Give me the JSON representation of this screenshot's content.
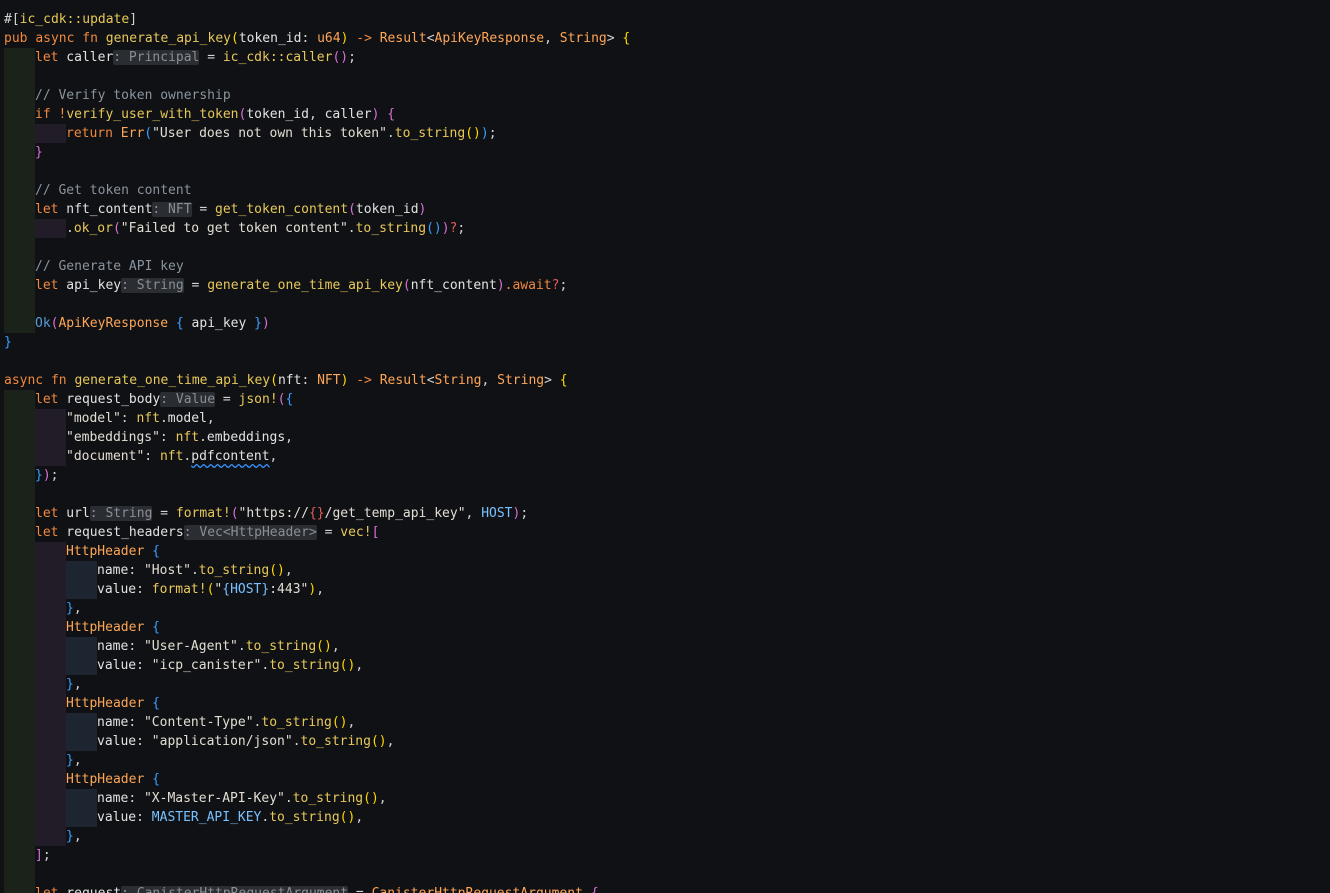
{
  "theme": {
    "background": "#0f1114",
    "colors": {
      "attr": "#d4d4d4",
      "kw": "#f0883e",
      "kwblue": "#569cd6",
      "fn": "#e8c85a",
      "type": "#ffa657",
      "str": "#e3ded3",
      "macro": "#e8c85a",
      "var": "#e2e2e2",
      "text": "#d4d4d4",
      "punct": "#d4d4d4",
      "comment": "#8b949e",
      "const": "#79c0ff",
      "b1": "#ffd700",
      "b2": "#da70d6",
      "b3": "#3aa0ff",
      "q": "#e05c5c"
    }
  },
  "code": [
    {
      "indent": 0,
      "tokens": [
        {
          "t": "#[",
          "c": "text"
        },
        {
          "t": "ic_cdk::update",
          "c": "fn"
        },
        {
          "t": "]",
          "c": "text"
        }
      ]
    },
    {
      "indent": 0,
      "tokens": [
        {
          "t": "pub",
          "c": "kw"
        },
        {
          "t": " ",
          "c": "text"
        },
        {
          "t": "async",
          "c": "kw"
        },
        {
          "t": " ",
          "c": "text"
        },
        {
          "t": "fn",
          "c": "kw"
        },
        {
          "t": " ",
          "c": "text"
        },
        {
          "t": "generate_api_key",
          "c": "fn"
        },
        {
          "t": "(",
          "c": "b1"
        },
        {
          "t": "token_id",
          "c": "var"
        },
        {
          "t": ": ",
          "c": "punct"
        },
        {
          "t": "u64",
          "c": "type"
        },
        {
          "t": ")",
          "c": "b1"
        },
        {
          "t": " -> ",
          "c": "kw"
        },
        {
          "t": "Result",
          "c": "type"
        },
        {
          "t": "<",
          "c": "punct"
        },
        {
          "t": "ApiKeyResponse",
          "c": "type"
        },
        {
          "t": ", ",
          "c": "punct"
        },
        {
          "t": "String",
          "c": "type"
        },
        {
          "t": ">",
          "c": "punct"
        },
        {
          "t": " ",
          "c": "text"
        },
        {
          "t": "{",
          "c": "b1"
        }
      ]
    },
    {
      "indent": 1,
      "tokens": [
        {
          "t": "let",
          "c": "kw"
        },
        {
          "t": " caller",
          "c": "var"
        },
        {
          "t": ": Principal",
          "c": "hint"
        },
        {
          "t": " = ",
          "c": "punct"
        },
        {
          "t": "ic_cdk::caller",
          "c": "fn"
        },
        {
          "t": "()",
          "c": "b2"
        },
        {
          "t": ";",
          "c": "punct"
        }
      ]
    },
    {
      "indent": 1,
      "tokens": []
    },
    {
      "indent": 1,
      "tokens": [
        {
          "t": "// Verify token ownership",
          "c": "comment"
        }
      ]
    },
    {
      "indent": 1,
      "tokens": [
        {
          "t": "if",
          "c": "kw"
        },
        {
          "t": " ",
          "c": "text"
        },
        {
          "t": "!",
          "c": "kw"
        },
        {
          "t": "verify_user_with_token",
          "c": "fn"
        },
        {
          "t": "(",
          "c": "b2"
        },
        {
          "t": "token_id",
          "c": "var"
        },
        {
          "t": ", ",
          "c": "punct"
        },
        {
          "t": "caller",
          "c": "var"
        },
        {
          "t": ")",
          "c": "b2"
        },
        {
          "t": " ",
          "c": "text"
        },
        {
          "t": "{",
          "c": "b2"
        }
      ]
    },
    {
      "indent": 2,
      "tokens": [
        {
          "t": "return",
          "c": "kw"
        },
        {
          "t": " ",
          "c": "text"
        },
        {
          "t": "Err",
          "c": "type"
        },
        {
          "t": "(",
          "c": "b3"
        },
        {
          "t": "\"User does not own this token\"",
          "c": "str"
        },
        {
          "t": ".",
          "c": "punct"
        },
        {
          "t": "to_string",
          "c": "fn"
        },
        {
          "t": "()",
          "c": "b1"
        },
        {
          "t": ")",
          "c": "b3"
        },
        {
          "t": ";",
          "c": "punct"
        }
      ]
    },
    {
      "indent": 1,
      "tokens": [
        {
          "t": "}",
          "c": "b2"
        }
      ]
    },
    {
      "indent": 1,
      "tokens": []
    },
    {
      "indent": 1,
      "tokens": [
        {
          "t": "// Get token content",
          "c": "comment"
        }
      ]
    },
    {
      "indent": 1,
      "tokens": [
        {
          "t": "let",
          "c": "kw"
        },
        {
          "t": " nft_content",
          "c": "var"
        },
        {
          "t": ": NFT",
          "c": "hint"
        },
        {
          "t": " = ",
          "c": "punct"
        },
        {
          "t": "get_token_content",
          "c": "fn"
        },
        {
          "t": "(",
          "c": "b2"
        },
        {
          "t": "token_id",
          "c": "var"
        },
        {
          "t": ")",
          "c": "b2"
        }
      ]
    },
    {
      "indent": 2,
      "tokens": [
        {
          "t": ".",
          "c": "punct"
        },
        {
          "t": "ok_or",
          "c": "fn"
        },
        {
          "t": "(",
          "c": "b2"
        },
        {
          "t": "\"Failed to get token content\"",
          "c": "str"
        },
        {
          "t": ".",
          "c": "punct"
        },
        {
          "t": "to_string",
          "c": "fn"
        },
        {
          "t": "()",
          "c": "b3"
        },
        {
          "t": ")",
          "c": "b2"
        },
        {
          "t": "?",
          "c": "q"
        },
        {
          "t": ";",
          "c": "punct"
        }
      ]
    },
    {
      "indent": 1,
      "tokens": []
    },
    {
      "indent": 1,
      "tokens": [
        {
          "t": "// Generate API key",
          "c": "comment"
        }
      ]
    },
    {
      "indent": 1,
      "tokens": [
        {
          "t": "let",
          "c": "kw"
        },
        {
          "t": " api_key",
          "c": "var"
        },
        {
          "t": ": String",
          "c": "hint"
        },
        {
          "t": " = ",
          "c": "punct"
        },
        {
          "t": "generate_one_time_api_key",
          "c": "fn"
        },
        {
          "t": "(",
          "c": "b2"
        },
        {
          "t": "nft_content",
          "c": "var"
        },
        {
          "t": ")",
          "c": "b2"
        },
        {
          "t": ".await",
          "c": "kw"
        },
        {
          "t": "?",
          "c": "q"
        },
        {
          "t": ";",
          "c": "punct"
        }
      ]
    },
    {
      "indent": 1,
      "tokens": []
    },
    {
      "indent": 1,
      "tokens": [
        {
          "t": "Ok",
          "c": "kwblue"
        },
        {
          "t": "(",
          "c": "b2"
        },
        {
          "t": "ApiKeyResponse",
          "c": "type"
        },
        {
          "t": " ",
          "c": "text"
        },
        {
          "t": "{",
          "c": "b3"
        },
        {
          "t": " api_key ",
          "c": "var"
        },
        {
          "t": "}",
          "c": "b3"
        },
        {
          "t": ")",
          "c": "b2"
        }
      ]
    },
    {
      "indent": 0,
      "tokens": [
        {
          "t": "}",
          "c": "b3"
        }
      ]
    },
    {
      "indent": 0,
      "tokens": []
    },
    {
      "indent": 0,
      "tokens": [
        {
          "t": "async",
          "c": "kw"
        },
        {
          "t": " ",
          "c": "text"
        },
        {
          "t": "fn",
          "c": "kw"
        },
        {
          "t": " ",
          "c": "text"
        },
        {
          "t": "generate_one_time_api_key",
          "c": "fn"
        },
        {
          "t": "(",
          "c": "b1"
        },
        {
          "t": "nft",
          "c": "var"
        },
        {
          "t": ": ",
          "c": "punct"
        },
        {
          "t": "NFT",
          "c": "type"
        },
        {
          "t": ")",
          "c": "b1"
        },
        {
          "t": " -> ",
          "c": "kw"
        },
        {
          "t": "Result",
          "c": "type"
        },
        {
          "t": "<",
          "c": "punct"
        },
        {
          "t": "String",
          "c": "type"
        },
        {
          "t": ", ",
          "c": "punct"
        },
        {
          "t": "String",
          "c": "type"
        },
        {
          "t": ">",
          "c": "punct"
        },
        {
          "t": " ",
          "c": "text"
        },
        {
          "t": "{",
          "c": "b1"
        }
      ]
    },
    {
      "indent": 1,
      "tokens": [
        {
          "t": "let",
          "c": "kw"
        },
        {
          "t": " request_body",
          "c": "var"
        },
        {
          "t": ": Value",
          "c": "hint"
        },
        {
          "t": " = ",
          "c": "punct"
        },
        {
          "t": "json!",
          "c": "macro"
        },
        {
          "t": "(",
          "c": "b2"
        },
        {
          "t": "{",
          "c": "b3"
        }
      ]
    },
    {
      "indent": 2,
      "tokens": [
        {
          "t": "\"model\"",
          "c": "str"
        },
        {
          "t": ": ",
          "c": "punct"
        },
        {
          "t": "nft",
          "c": "fn"
        },
        {
          "t": ".",
          "c": "punct"
        },
        {
          "t": "model",
          "c": "var"
        },
        {
          "t": ",",
          "c": "punct"
        }
      ]
    },
    {
      "indent": 2,
      "tokens": [
        {
          "t": "\"embeddings\"",
          "c": "str"
        },
        {
          "t": ": ",
          "c": "punct"
        },
        {
          "t": "nft",
          "c": "fn"
        },
        {
          "t": ".",
          "c": "punct"
        },
        {
          "t": "embeddings",
          "c": "var"
        },
        {
          "t": ",",
          "c": "punct"
        }
      ]
    },
    {
      "indent": 2,
      "tokens": [
        {
          "t": "\"document\"",
          "c": "str"
        },
        {
          "t": ": ",
          "c": "punct"
        },
        {
          "t": "nft",
          "c": "fn"
        },
        {
          "t": ".",
          "c": "punct"
        },
        {
          "t": "pdfcontent",
          "c": "var",
          "squiggle": true
        },
        {
          "t": ",",
          "c": "punct"
        }
      ]
    },
    {
      "indent": 1,
      "tokens": [
        {
          "t": "}",
          "c": "b3"
        },
        {
          "t": ")",
          "c": "b2"
        },
        {
          "t": ";",
          "c": "punct"
        }
      ]
    },
    {
      "indent": 1,
      "tokens": []
    },
    {
      "indent": 1,
      "tokens": [
        {
          "t": "let",
          "c": "kw"
        },
        {
          "t": " url",
          "c": "var"
        },
        {
          "t": ": String",
          "c": "hint"
        },
        {
          "t": " = ",
          "c": "punct"
        },
        {
          "t": "format!",
          "c": "macro"
        },
        {
          "t": "(",
          "c": "b2"
        },
        {
          "t": "\"https://",
          "c": "str"
        },
        {
          "t": "{}",
          "c": "q"
        },
        {
          "t": "/get_temp_api_key\"",
          "c": "str"
        },
        {
          "t": ", ",
          "c": "punct"
        },
        {
          "t": "HOST",
          "c": "const"
        },
        {
          "t": ")",
          "c": "b2"
        },
        {
          "t": ";",
          "c": "punct"
        }
      ]
    },
    {
      "indent": 1,
      "tokens": [
        {
          "t": "let",
          "c": "kw"
        },
        {
          "t": " request_headers",
          "c": "var"
        },
        {
          "t": ": Vec<HttpHeader>",
          "c": "hint"
        },
        {
          "t": " = ",
          "c": "punct"
        },
        {
          "t": "vec!",
          "c": "macro"
        },
        {
          "t": "[",
          "c": "b2"
        }
      ]
    },
    {
      "indent": 2,
      "tokens": [
        {
          "t": "HttpHeader",
          "c": "type"
        },
        {
          "t": " ",
          "c": "text"
        },
        {
          "t": "{",
          "c": "b3"
        }
      ]
    },
    {
      "indent": 3,
      "tokens": [
        {
          "t": "name",
          "c": "var"
        },
        {
          "t": ": ",
          "c": "punct"
        },
        {
          "t": "\"Host\"",
          "c": "str"
        },
        {
          "t": ".",
          "c": "punct"
        },
        {
          "t": "to_string",
          "c": "fn"
        },
        {
          "t": "()",
          "c": "b1"
        },
        {
          "t": ",",
          "c": "punct"
        }
      ]
    },
    {
      "indent": 3,
      "tokens": [
        {
          "t": "value",
          "c": "var"
        },
        {
          "t": ": ",
          "c": "punct"
        },
        {
          "t": "format!",
          "c": "macro"
        },
        {
          "t": "(",
          "c": "b1"
        },
        {
          "t": "\"",
          "c": "str"
        },
        {
          "t": "{HOST}",
          "c": "const"
        },
        {
          "t": ":443\"",
          "c": "str"
        },
        {
          "t": ")",
          "c": "b1"
        },
        {
          "t": ",",
          "c": "punct"
        }
      ]
    },
    {
      "indent": 2,
      "tokens": [
        {
          "t": "}",
          "c": "b3"
        },
        {
          "t": ",",
          "c": "punct"
        }
      ]
    },
    {
      "indent": 2,
      "tokens": [
        {
          "t": "HttpHeader",
          "c": "type"
        },
        {
          "t": " ",
          "c": "text"
        },
        {
          "t": "{",
          "c": "b3"
        }
      ]
    },
    {
      "indent": 3,
      "tokens": [
        {
          "t": "name",
          "c": "var"
        },
        {
          "t": ": ",
          "c": "punct"
        },
        {
          "t": "\"User-Agent\"",
          "c": "str"
        },
        {
          "t": ".",
          "c": "punct"
        },
        {
          "t": "to_string",
          "c": "fn"
        },
        {
          "t": "()",
          "c": "b1"
        },
        {
          "t": ",",
          "c": "punct"
        }
      ]
    },
    {
      "indent": 3,
      "tokens": [
        {
          "t": "value",
          "c": "var"
        },
        {
          "t": ": ",
          "c": "punct"
        },
        {
          "t": "\"icp_canister\"",
          "c": "str"
        },
        {
          "t": ".",
          "c": "punct"
        },
        {
          "t": "to_string",
          "c": "fn"
        },
        {
          "t": "()",
          "c": "b1"
        },
        {
          "t": ",",
          "c": "punct"
        }
      ]
    },
    {
      "indent": 2,
      "tokens": [
        {
          "t": "}",
          "c": "b3"
        },
        {
          "t": ",",
          "c": "punct"
        }
      ]
    },
    {
      "indent": 2,
      "tokens": [
        {
          "t": "HttpHeader",
          "c": "type"
        },
        {
          "t": " ",
          "c": "text"
        },
        {
          "t": "{",
          "c": "b3"
        }
      ]
    },
    {
      "indent": 3,
      "tokens": [
        {
          "t": "name",
          "c": "var"
        },
        {
          "t": ": ",
          "c": "punct"
        },
        {
          "t": "\"Content-Type\"",
          "c": "str"
        },
        {
          "t": ".",
          "c": "punct"
        },
        {
          "t": "to_string",
          "c": "fn"
        },
        {
          "t": "()",
          "c": "b1"
        },
        {
          "t": ",",
          "c": "punct"
        }
      ]
    },
    {
      "indent": 3,
      "tokens": [
        {
          "t": "value",
          "c": "var"
        },
        {
          "t": ": ",
          "c": "punct"
        },
        {
          "t": "\"application/json\"",
          "c": "str"
        },
        {
          "t": ".",
          "c": "punct"
        },
        {
          "t": "to_string",
          "c": "fn"
        },
        {
          "t": "()",
          "c": "b1"
        },
        {
          "t": ",",
          "c": "punct"
        }
      ]
    },
    {
      "indent": 2,
      "tokens": [
        {
          "t": "}",
          "c": "b3"
        },
        {
          "t": ",",
          "c": "punct"
        }
      ]
    },
    {
      "indent": 2,
      "tokens": [
        {
          "t": "HttpHeader",
          "c": "type"
        },
        {
          "t": " ",
          "c": "text"
        },
        {
          "t": "{",
          "c": "b3"
        }
      ]
    },
    {
      "indent": 3,
      "tokens": [
        {
          "t": "name",
          "c": "var"
        },
        {
          "t": ": ",
          "c": "punct"
        },
        {
          "t": "\"X-Master-API-Key\"",
          "c": "str"
        },
        {
          "t": ".",
          "c": "punct"
        },
        {
          "t": "to_string",
          "c": "fn"
        },
        {
          "t": "()",
          "c": "b1"
        },
        {
          "t": ",",
          "c": "punct"
        }
      ]
    },
    {
      "indent": 3,
      "tokens": [
        {
          "t": "value",
          "c": "var"
        },
        {
          "t": ": ",
          "c": "punct"
        },
        {
          "t": "MASTER_API_KEY",
          "c": "const"
        },
        {
          "t": ".",
          "c": "punct"
        },
        {
          "t": "to_string",
          "c": "fn"
        },
        {
          "t": "()",
          "c": "b1"
        },
        {
          "t": ",",
          "c": "punct"
        }
      ]
    },
    {
      "indent": 2,
      "tokens": [
        {
          "t": "}",
          "c": "b3"
        },
        {
          "t": ",",
          "c": "punct"
        }
      ]
    },
    {
      "indent": 1,
      "tokens": [
        {
          "t": "]",
          "c": "b2"
        },
        {
          "t": ";",
          "c": "punct"
        }
      ]
    },
    {
      "indent": 1,
      "tokens": []
    },
    {
      "indent": 1,
      "tokens": [
        {
          "t": "let",
          "c": "kw"
        },
        {
          "t": " request",
          "c": "var"
        },
        {
          "t": ": CanisterHttpRequestArgument",
          "c": "hint"
        },
        {
          "t": " = ",
          "c": "punct"
        },
        {
          "t": "CanisterHttpRequestArgument",
          "c": "type"
        },
        {
          "t": " ",
          "c": "text"
        },
        {
          "t": "{",
          "c": "b2"
        }
      ]
    }
  ]
}
